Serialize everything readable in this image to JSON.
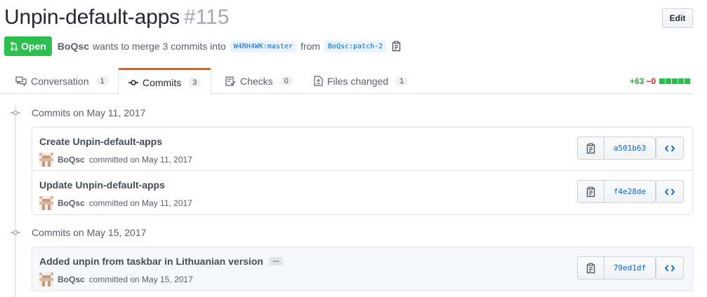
{
  "header": {
    "title": "Unpin-default-apps",
    "number": "#115",
    "edit_label": "Edit"
  },
  "meta": {
    "state": "Open",
    "author": "BoQsc",
    "text": "wants to merge 3 commits into",
    "base_branch": "W4RH4WK:master",
    "from_text": "from",
    "head_branch": "BoQsc:patch-2"
  },
  "tabs": [
    {
      "label": "Conversation",
      "count": "1"
    },
    {
      "label": "Commits",
      "count": "3"
    },
    {
      "label": "Checks",
      "count": "0"
    },
    {
      "label": "Files changed",
      "count": "1"
    }
  ],
  "diffstat": {
    "additions": "+63",
    "deletions": "−0"
  },
  "commit_groups": [
    {
      "header": "Commits on May 11, 2017",
      "commits": [
        {
          "title": "Create Unpin-default-apps",
          "author": "BoQsc",
          "committed": "committed on May 11, 2017",
          "sha": "a501b63"
        },
        {
          "title": "Update Unpin-default-apps",
          "author": "BoQsc",
          "committed": "committed on May 11, 2017",
          "sha": "f4e28de"
        }
      ]
    },
    {
      "header": "Commits on May 15, 2017",
      "commits": [
        {
          "title": "Added unpin from taskbar in Lithuanian version",
          "author": "BoQsc",
          "committed": "committed on May 15, 2017",
          "sha": "79ed1df",
          "ellipsis": "…"
        }
      ]
    }
  ],
  "colors": {
    "open_green": "#2cbe4e",
    "link_blue": "#0366d6",
    "tab_accent": "#e36209"
  }
}
